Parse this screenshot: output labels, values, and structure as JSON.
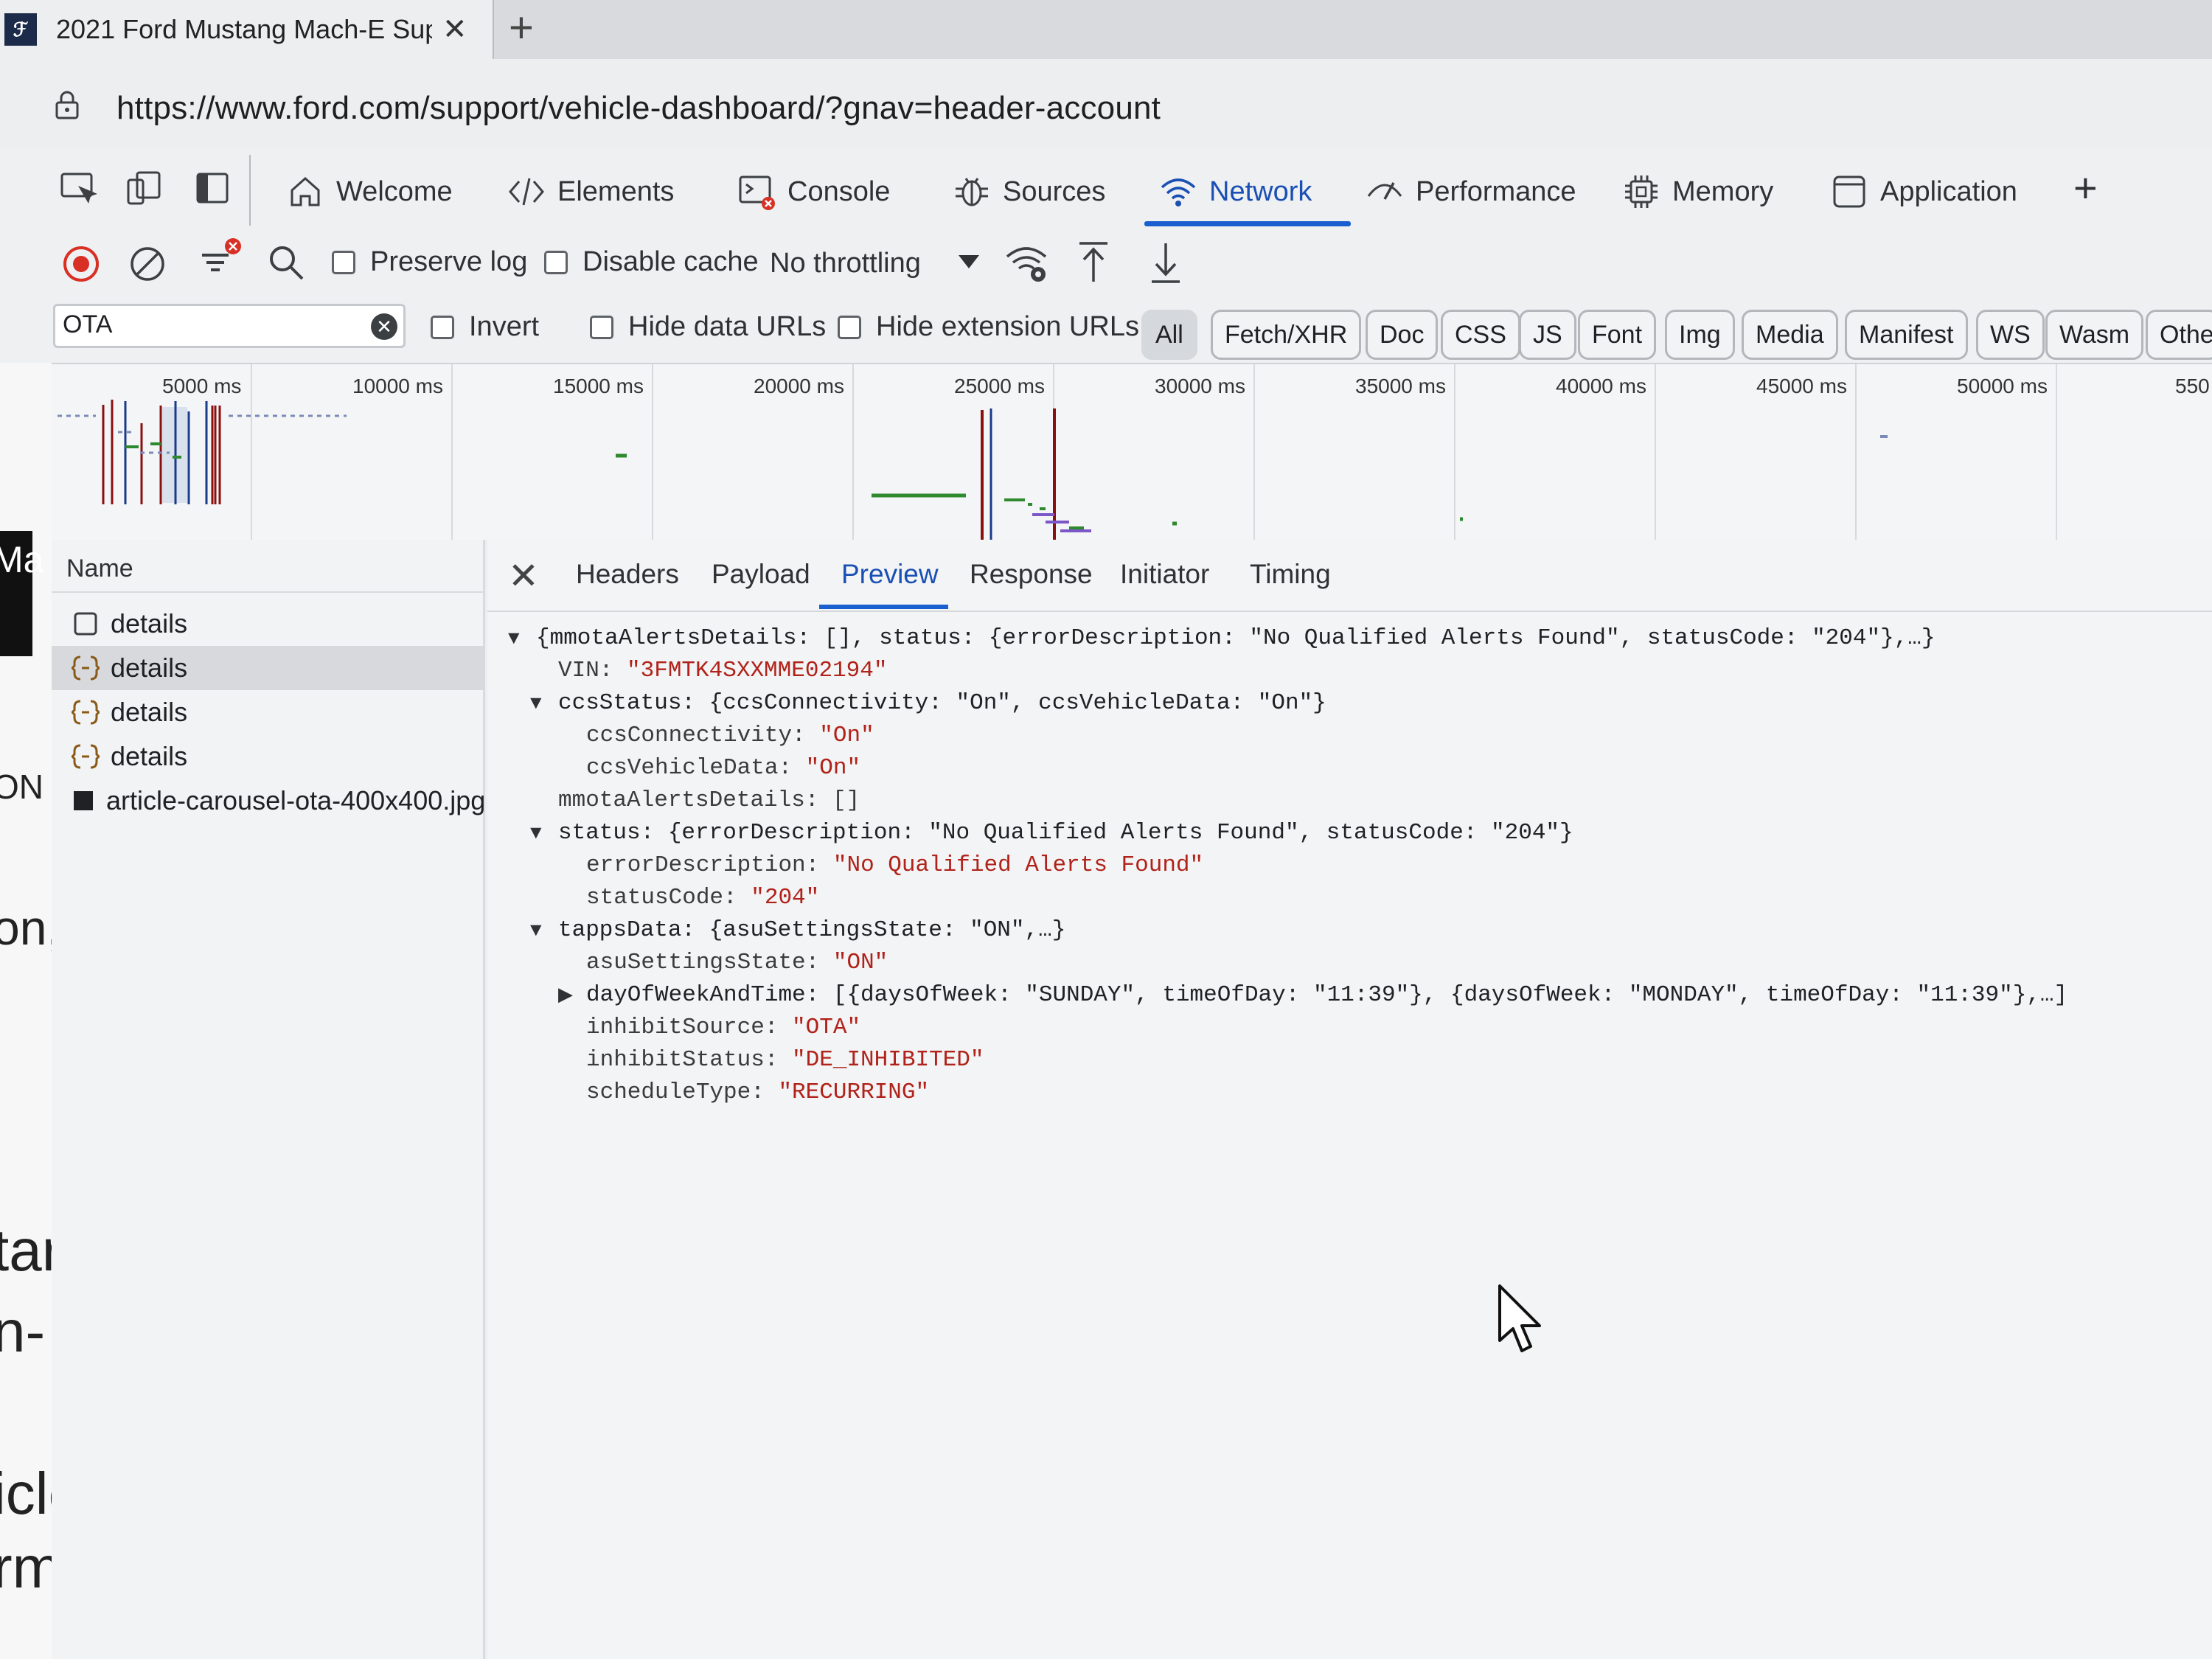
{
  "browser": {
    "tab_title": "2021 Ford Mustang Mach-E Sup",
    "url": "https://www.ford.com/support/vehicle-dashboard/?gnav=header-account"
  },
  "devtools": {
    "tabs": [
      {
        "label": "Welcome",
        "icon": "home-icon"
      },
      {
        "label": "Elements",
        "icon": "code-icon"
      },
      {
        "label": "Console",
        "icon": "console-icon"
      },
      {
        "label": "Sources",
        "icon": "bug-icon"
      },
      {
        "label": "Network",
        "icon": "wifi-icon",
        "active": true
      },
      {
        "label": "Performance",
        "icon": "performance-icon"
      },
      {
        "label": "Memory",
        "icon": "chip-icon"
      },
      {
        "label": "Application",
        "icon": "application-icon"
      }
    ]
  },
  "network": {
    "toolbar": {
      "preserve_log": "Preserve log",
      "disable_cache": "Disable cache",
      "throttling": "No throttling"
    },
    "filter": {
      "value": "OTA",
      "invert": "Invert",
      "hide_data_urls": "Hide data URLs",
      "hide_extension_urls": "Hide extension URLs",
      "types": [
        "All",
        "Fetch/XHR",
        "Doc",
        "CSS",
        "JS",
        "Font",
        "Img",
        "Media",
        "Manifest",
        "WS",
        "Wasm",
        "Othe"
      ]
    },
    "overview_ticks": [
      "5000 ms",
      "10000 ms",
      "15000 ms",
      "20000 ms",
      "25000 ms",
      "30000 ms",
      "35000 ms",
      "40000 ms",
      "45000 ms",
      "50000 ms",
      "550"
    ],
    "requests": {
      "header": "Name",
      "rows": [
        "details",
        "details",
        "details",
        "details",
        "article-carousel-ota-400x400.jpg"
      ]
    }
  },
  "detail": {
    "tabs": [
      "Headers",
      "Payload",
      "Preview",
      "Response",
      "Initiator",
      "Timing"
    ],
    "json": {
      "root": "{mmotaAlertsDetails: [], status: {errorDescription: \"No Qualified Alerts Found\", statusCode: \"204\"},…}",
      "vin_key": "VIN: ",
      "vin_val": "\"3FMTK4SXXMME02194\"",
      "ccs_summary": "ccsStatus: {ccsConnectivity: \"On\", ccsVehicleData: \"On\"}",
      "ccs_conn_key": "ccsConnectivity: ",
      "ccs_conn_val": "\"On\"",
      "ccs_data_key": "ccsVehicleData: ",
      "ccs_data_val": "\"On\"",
      "mmota": "mmotaAlertsDetails: []",
      "status_summary": "status: {errorDescription: \"No Qualified Alerts Found\", statusCode: \"204\"}",
      "err_key": "errorDescription: ",
      "err_val": "\"No Qualified Alerts Found\"",
      "code_key": "statusCode: ",
      "code_val": "\"204\"",
      "tapps_summary": "tappsData: {asuSettingsState: \"ON\",…}",
      "asu_key": "asuSettingsState: ",
      "asu_val": "\"ON\"",
      "dow_summary": "dayOfWeekAndTime: [{daysOfWeek: \"SUNDAY\", timeOfDay: \"11:39\"}, {daysOfWeek: \"MONDAY\", timeOfDay: \"11:39\"},…]",
      "inhibit_src_key": "inhibitSource: ",
      "inhibit_src_val": "\"OTA\"",
      "inhibit_status_key": "inhibitStatus: ",
      "inhibit_status_val": "\"DE_INHIBITED\"",
      "schedule_key": "scheduleType: ",
      "schedule_val": "\"RECURRING\""
    }
  },
  "page_behind": {
    "fragments": [
      "Ma",
      "ON",
      "on,",
      "tar",
      "n-",
      "icle",
      "rm."
    ]
  },
  "colors": {
    "accent": "#1a5fd0",
    "string": "#b0221a",
    "record": "#d93025"
  }
}
